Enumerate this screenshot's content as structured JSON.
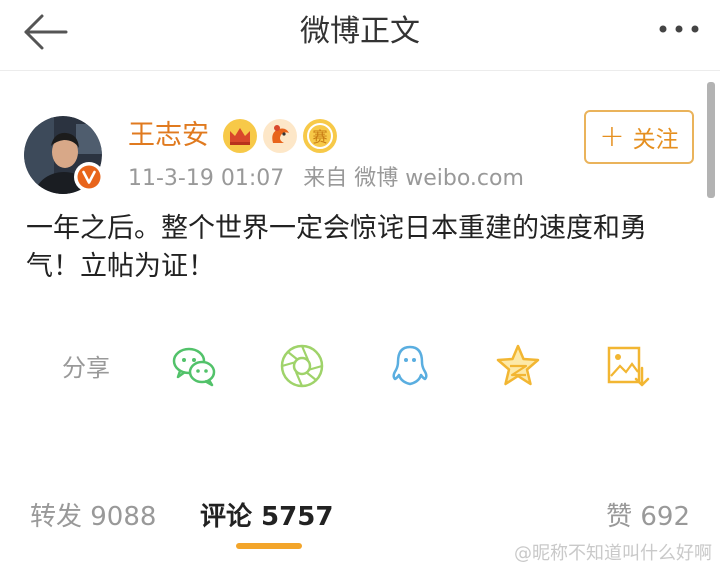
{
  "header": {
    "title": "微博正文",
    "back_icon": "arrow-left-icon",
    "more_icon": "more-dots-icon"
  },
  "post": {
    "author": "王志安",
    "timestamp": "11-3-19 01:07",
    "source": "来自 微博 weibo.com",
    "follow_label": "关注",
    "text": "一年之后。整个世界一定会惊诧日本重建的速度和勇气！立帖为证！",
    "badges": [
      "crown-icon",
      "rooster-icon",
      "sport-badge-icon"
    ]
  },
  "share": {
    "label": "分享",
    "targets": [
      "wechat-icon",
      "moments-icon",
      "qq-icon",
      "qzone-icon",
      "save-image-icon"
    ]
  },
  "stats": {
    "forward": "转发 9088",
    "comment": "评论 5757",
    "like": "赞 692"
  },
  "watermark": "@昵称不知道叫什么好啊",
  "colors": {
    "accent": "#f3a52a",
    "username": "#e07a1f",
    "share_green": "#52c26a",
    "share_blue": "#5aaee0",
    "share_yellow": "#f2b632"
  }
}
